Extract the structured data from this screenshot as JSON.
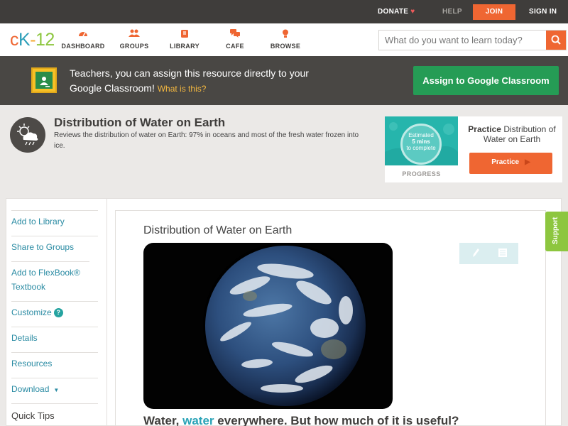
{
  "topbar": {
    "donate": "DONATE",
    "help": "HELP",
    "join": "JOIN",
    "sign_in": "SIGN IN"
  },
  "nav": {
    "logo": {
      "c": "c",
      "k": "K",
      "dash": "-",
      "n12": "12"
    },
    "items": [
      {
        "label": "DASHBOARD",
        "icon": "dashboard-icon"
      },
      {
        "label": "GROUPS",
        "icon": "groups-icon"
      },
      {
        "label": "LIBRARY",
        "icon": "library-icon"
      },
      {
        "label": "CAFE",
        "icon": "cafe-icon"
      },
      {
        "label": "BROWSE",
        "icon": "browse-icon"
      }
    ],
    "search_placeholder": "What do you want to learn today?"
  },
  "classroom_banner": {
    "text": "Teachers, you can assign this resource directly to your Google Classroom!",
    "link": "What is this?",
    "button": "Assign to Google Classroom"
  },
  "concept": {
    "title": "Distribution of Water on Earth",
    "description": "Reviews the distribution of water on Earth: 97% in oceans and most of the fresh water frozen into ice."
  },
  "practice": {
    "estimated": "Estimated",
    "mins": "5 mins",
    "to_complete": "to complete",
    "progress_label": "PROGRESS",
    "title_bold": "Practice",
    "title_rest": "Distribution of Water on Earth",
    "button": "Practice"
  },
  "sidebar": {
    "items": [
      {
        "label": "Add to Library"
      },
      {
        "label": "Share to Groups"
      },
      {
        "label": "Add to FlexBook® Textbook"
      },
      {
        "label": "Customize"
      },
      {
        "label": "Details"
      },
      {
        "label": "Resources"
      },
      {
        "label": "Download"
      },
      {
        "label": "Quick Tips"
      }
    ]
  },
  "article": {
    "title": "Distribution of Water on Earth",
    "lead_start": "Water,",
    "lead_keyword": "water",
    "lead_end": "everywhere. But how much of it is useful?"
  },
  "support_tab": "Support",
  "colors": {
    "accent_orange": "#ef6632",
    "link_teal": "#2a8ba3",
    "google_green": "#259c55",
    "support_green": "#8dc63f"
  }
}
